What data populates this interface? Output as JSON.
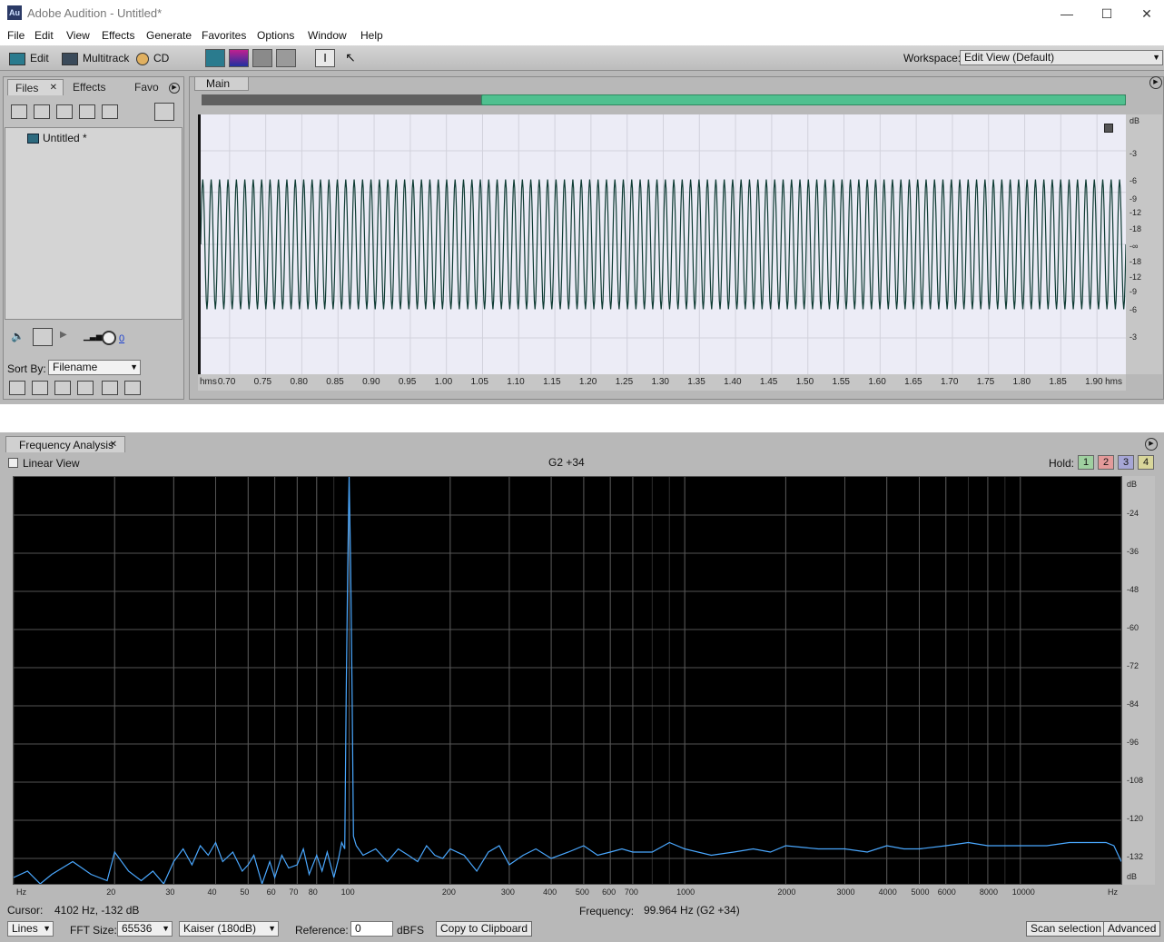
{
  "window": {
    "title": "Adobe Audition - Untitled*",
    "icon_text": "Au",
    "minimize": "—",
    "maximize": "☐",
    "close": "✕"
  },
  "menu": [
    "File",
    "Edit",
    "View",
    "Effects",
    "Generate",
    "Favorites",
    "Options",
    "Window",
    "Help"
  ],
  "toolbar": {
    "edit_label": "Edit",
    "multitrack_label": "Multitrack",
    "cd_label": "CD",
    "workspace_label": "Workspace:",
    "workspace_value": "Edit View (Default)"
  },
  "files_panel": {
    "tabs": [
      "Files",
      "Effects",
      "Favo"
    ],
    "tab_close": "✕",
    "items": [
      "Untitled *"
    ],
    "volume_value": "0",
    "sort_label": "Sort By:",
    "sort_value": "Filename"
  },
  "main_panel": {
    "tab": "Main",
    "db_unit": "dB",
    "db_ticks": [
      "-3",
      "-6",
      "-9",
      "-12",
      "-18",
      "-∞",
      "-18",
      "-12",
      "-9",
      "-6",
      "-3"
    ],
    "time_unit": "hms",
    "time_ticks": [
      "0.70",
      "0.75",
      "0.80",
      "0.85",
      "0.90",
      "0.95",
      "1.00",
      "1.05",
      "1.10",
      "1.15",
      "1.20",
      "1.25",
      "1.30",
      "1.35",
      "1.40",
      "1.45",
      "1.50",
      "1.55",
      "1.60",
      "1.65",
      "1.70",
      "1.75",
      "1.80",
      "1.85",
      "1.90"
    ],
    "time_unit_right": "hms",
    "waveform": {
      "cycles": 110,
      "amplitude_fraction": 0.5,
      "start_time": 0.66,
      "end_time": 1.94
    }
  },
  "freq_panel": {
    "tab": "Frequency Analysis",
    "tab_close": "✕",
    "linear_view": "Linear View",
    "note": "G2 +34",
    "hold_label": "Hold:",
    "hold_buttons": [
      "1",
      "2",
      "3",
      "4"
    ],
    "hold_colors": [
      "#9fd0a0",
      "#e39a9a",
      "#a6a6d6",
      "#d8d69a"
    ],
    "cursor_label": "Cursor:",
    "cursor_value": "4102 Hz,  -132 dB",
    "frequency_label": "Frequency:",
    "frequency_value": "99.964 Hz (G2 +34)",
    "display_mode": "Lines",
    "fft_label": "FFT Size:",
    "fft_value": "65536",
    "window_value": "Kaiser (180dB)",
    "reference_label": "Reference:",
    "reference_value": "0",
    "reference_unit": "dBFS",
    "copy_button": "Copy to Clipboard",
    "scan_button": "Scan selection",
    "advanced_button": "Advanced",
    "line_color": "#4aa8ff"
  },
  "chart_data": {
    "type": "line",
    "xscale": "log",
    "xlim": [
      10,
      20000
    ],
    "ylim": [
      -140,
      -12
    ],
    "x_unit_left": "Hz",
    "x_unit_right": "Hz",
    "y_unit": "dB",
    "x_ticks": [
      20,
      30,
      40,
      50,
      60,
      70,
      80,
      100,
      200,
      300,
      400,
      500,
      600,
      700,
      1000,
      2000,
      3000,
      4000,
      5000,
      6000,
      8000,
      10000
    ],
    "y_ticks": [
      -24,
      -36,
      -48,
      -60,
      -72,
      -84,
      -96,
      -108,
      -120,
      -132
    ],
    "peak": {
      "x": 99.964,
      "y": -12
    },
    "series": [
      {
        "x": [
          10,
          11,
          12,
          13,
          15,
          17,
          19,
          20,
          22,
          24,
          26,
          28,
          30,
          32,
          34,
          36,
          38,
          40,
          42,
          45,
          48,
          50,
          52,
          55,
          58,
          60,
          63,
          66,
          70,
          73,
          76,
          80,
          83,
          86,
          90,
          93,
          95,
          97,
          98,
          99,
          99.964,
          101,
          102,
          103,
          105,
          110,
          120,
          130,
          140,
          150,
          160,
          170,
          180,
          190,
          200,
          220,
          240,
          260,
          280,
          300,
          330,
          360,
          400,
          450,
          500,
          550,
          600,
          650,
          700,
          800,
          900,
          1000,
          1200,
          1400,
          1600,
          1800,
          2000,
          2500,
          3000,
          3500,
          4000,
          4500,
          5000,
          6000,
          7000,
          8000,
          9000,
          10000,
          12000,
          14000,
          16000,
          18000,
          19000,
          20000
        ],
        "y": [
          -138,
          -136,
          -140,
          -137,
          -133,
          -137,
          -139,
          -130,
          -136,
          -139,
          -136,
          -140,
          -133,
          -129,
          -134,
          -128,
          -131,
          -127,
          -133,
          -130,
          -136,
          -134,
          -131,
          -140,
          -133,
          -138,
          -131,
          -135,
          -134,
          -129,
          -137,
          -131,
          -136,
          -130,
          -138,
          -132,
          -127,
          -129,
          -80,
          -40,
          -12,
          -40,
          -80,
          -125,
          -128,
          -131,
          -129,
          -133,
          -129,
          -131,
          -133,
          -128,
          -131,
          -132,
          -129,
          -131,
          -136,
          -130,
          -128,
          -134,
          -131,
          -129,
          -132,
          -130,
          -128,
          -131,
          -130,
          -129,
          -130,
          -130,
          -127,
          -129,
          -131,
          -130,
          -129,
          -130,
          -128,
          -129,
          -129,
          -130,
          -128,
          -129,
          -129,
          -128,
          -127,
          -128,
          -128,
          -128,
          -128,
          -127,
          -127,
          -127,
          -128,
          -133
        ]
      }
    ]
  }
}
